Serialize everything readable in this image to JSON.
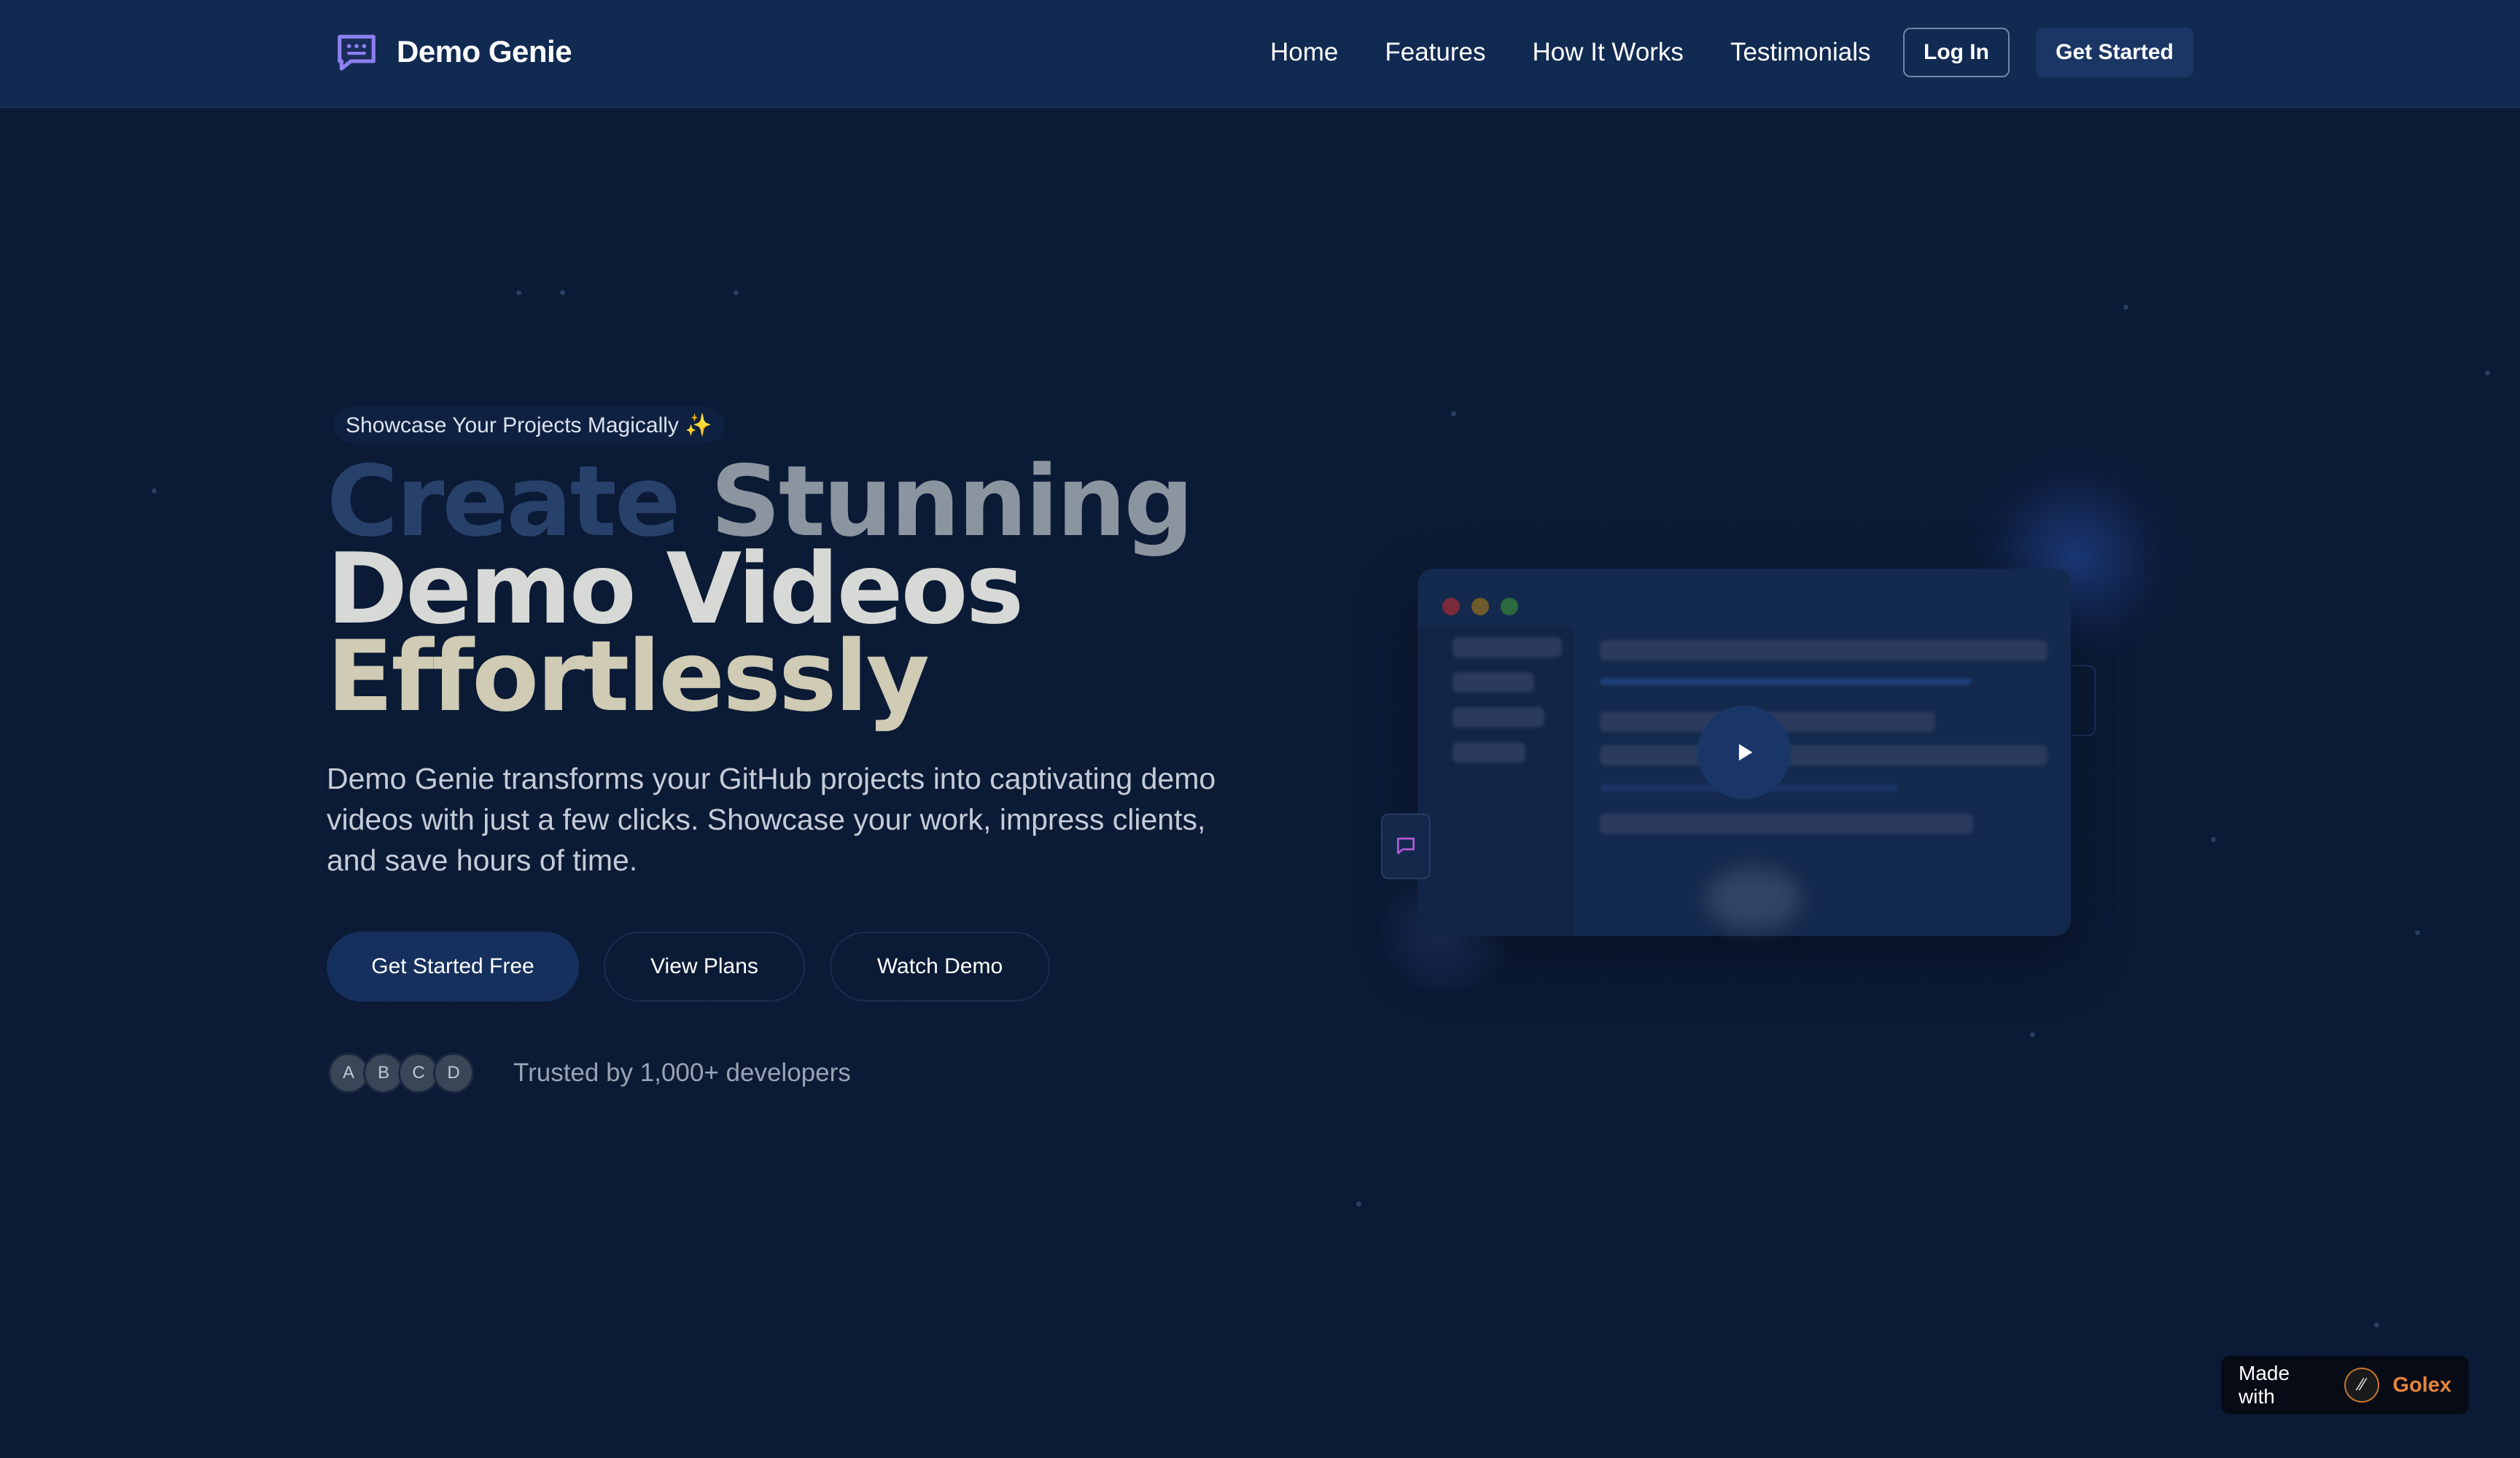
{
  "nav": {
    "brand": "Demo Genie",
    "links": [
      "Home",
      "Features",
      "How It Works",
      "Testimonials"
    ],
    "login_label": "Log In",
    "get_started_label": "Get Started"
  },
  "hero": {
    "badge": "Showcase Your Projects Magically ✨",
    "headline": {
      "line1_part1": "Create",
      "line1_part2": "Stunning",
      "line2": "Demo Videos",
      "line3": "Effortlessly"
    },
    "subtitle": "Demo Genie transforms your GitHub projects into captivating demo videos with just a few clicks. Showcase your work, impress clients, and save hours of time.",
    "buttons": {
      "primary": "Get Started Free",
      "plans": "View Plans",
      "demo": "Watch Demo"
    },
    "avatars": [
      "A",
      "B",
      "C",
      "D"
    ],
    "trusted_text": "Trusted by 1,000+ developers"
  },
  "mockup": {
    "window_dots": [
      "#7a2a3a",
      "#6e5a2a",
      "#2a6a3e"
    ],
    "play_icon": "play-icon"
  },
  "footer_badge": {
    "made_with": "Made with",
    "brand": "Golex"
  },
  "colors": {
    "background": "#0b1a35",
    "nav": "#112a52",
    "accent_orange": "#e6853b"
  }
}
